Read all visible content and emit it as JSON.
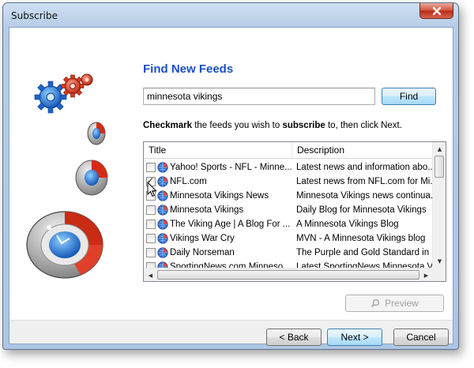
{
  "window": {
    "title": "Subscribe"
  },
  "page": {
    "heading": "Find New Feeds",
    "search": {
      "value": "minnesota vikings",
      "find_label": "Find"
    },
    "instructions": {
      "part1": "Checkmark",
      "part2": " the feeds you wish to ",
      "part3": "subscribe",
      "part4": " to, then click Next."
    }
  },
  "list": {
    "columns": [
      "Title",
      "Description"
    ],
    "rows": [
      {
        "title": "Yahoo! Sports - NFL - Minne...",
        "description": "Latest news and information abo...",
        "checked": false
      },
      {
        "title": "NFL.com",
        "description": "Latest news from NFL.com for Mi...",
        "checked": true
      },
      {
        "title": "Minnesota Vikings News",
        "description": "Minnesota Vikings news continua...",
        "checked": false
      },
      {
        "title": "Minnesota Vikings",
        "description": "Daily Blog for Minnesota Vikings",
        "checked": false
      },
      {
        "title": "The Viking Age | A Blog For ...",
        "description": "A Minnesota Vikings Blog",
        "checked": false
      },
      {
        "title": "Vikings War Cry",
        "description": "MVN - A Minnesota Vikings blog",
        "checked": false
      },
      {
        "title": "Daily Norseman",
        "description": "The Purple and Gold Standard in ...",
        "checked": false
      },
      {
        "title": "SportingNews.com Minneso...",
        "description": "Latest SportingNews Minnesota V...",
        "checked": false
      }
    ]
  },
  "buttons": {
    "preview": "Preview",
    "back": "< Back",
    "next": "Next >",
    "cancel": "Cancel"
  },
  "colors": {
    "heading": "#1b4fc4",
    "accent": "#3c7fb1"
  },
  "icons": [
    "close-icon",
    "gears-icon",
    "feed-globe-icon",
    "magnifier-icon",
    "mouse-cursor-icon"
  ]
}
